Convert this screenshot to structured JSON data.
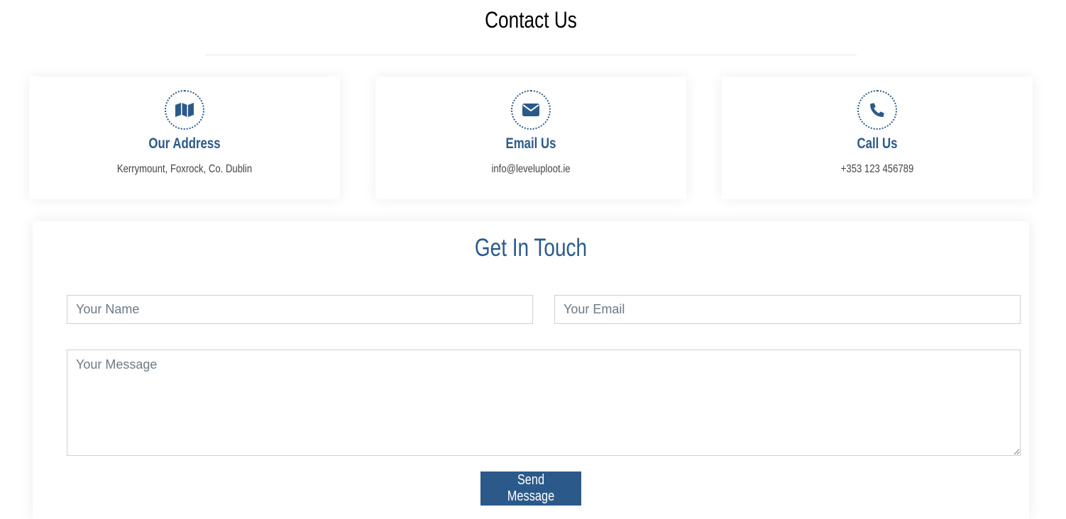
{
  "page": {
    "title": "Contact Us"
  },
  "cards": [
    {
      "icon": "map-icon",
      "heading": "Our Address",
      "text": "Kerrymount, Foxrock, Co. Dublin"
    },
    {
      "icon": "envelope-icon",
      "heading": "Email Us",
      "text": "info@leveluploot.ie"
    },
    {
      "icon": "phone-icon",
      "heading": "Call Us",
      "text": "+353 123 456789"
    }
  ],
  "form": {
    "heading": "Get In Touch",
    "name_placeholder": "Your Name",
    "email_placeholder": "Your Email",
    "message_placeholder": "Your Message",
    "submit_label": "Send Message"
  },
  "colors": {
    "accent": "#2b5a8a",
    "text": "#444444",
    "divider": "#e6e6e6"
  }
}
